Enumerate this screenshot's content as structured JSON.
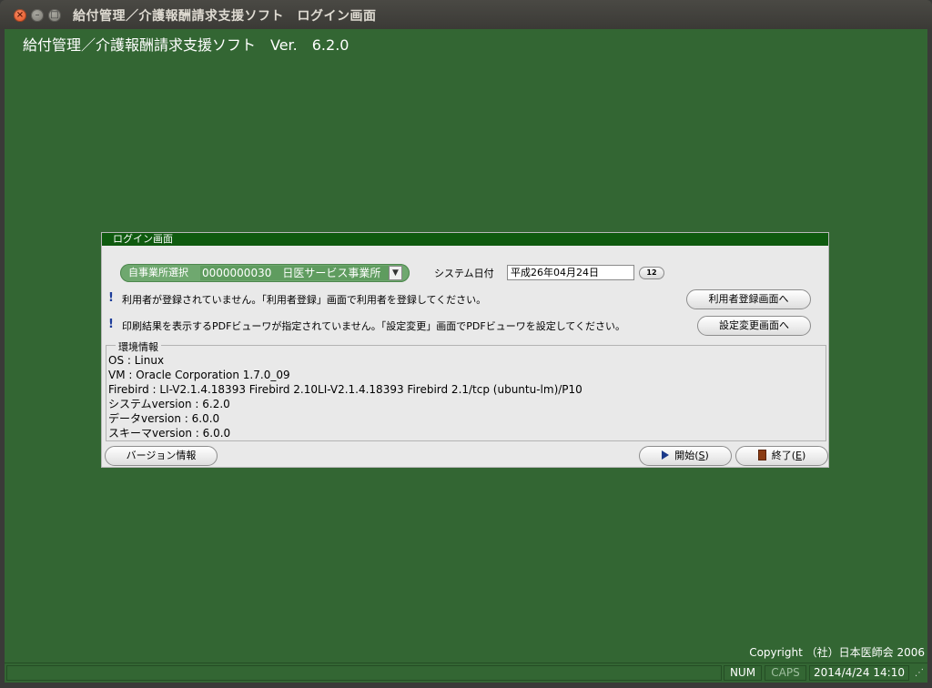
{
  "window": {
    "title": "給付管理／介護報酬請求支援ソフト　ログイン画面"
  },
  "app": {
    "heading": "給付管理／介護報酬請求支援ソフト　Ver.　6.2.0"
  },
  "panel": {
    "title": "ログイン画面",
    "office": {
      "label": "自事業所選択",
      "value": "0000000030　日医サービス事業所"
    },
    "system_date": {
      "label": "システム日付",
      "value": "平成26年04月24日",
      "calendar_label": "12"
    },
    "messages": [
      {
        "text": "利用者が登録されていません。「利用者登録」画面で利用者を登録してください。",
        "button": "利用者登録画面へ"
      },
      {
        "text": "印刷結果を表示するPDFビューワが指定されていません。「設定変更」画面でPDFビューワを設定してください。",
        "button": "設定変更画面へ"
      }
    ],
    "environment": {
      "legend": "環境情報",
      "lines": [
        "OS : Linux",
        "VM : Oracle Corporation 1.7.0_09",
        "Firebird : LI-V2.1.4.18393 Firebird 2.10LI-V2.1.4.18393 Firebird 2.1/tcp (ubuntu-lm)/P10",
        "システムversion : 6.2.0",
        "データversion : 6.0.0",
        "スキーマversion : 6.0.0"
      ]
    },
    "buttons": {
      "version": "バージョン情報",
      "start_label": "開始(",
      "start_key": "S",
      "start_close": ")",
      "exit_label": "終了(",
      "exit_key": "E",
      "exit_close": ")"
    }
  },
  "footer": {
    "copyright": "Copyright （社）日本医師会 2006"
  },
  "statusbar": {
    "num": "NUM",
    "caps": "CAPS",
    "datetime": "2014/4/24 14:10"
  },
  "colors": {
    "background": "#336633",
    "panel_title": "#0f5a0f",
    "titlebar": "#3c3b37"
  }
}
